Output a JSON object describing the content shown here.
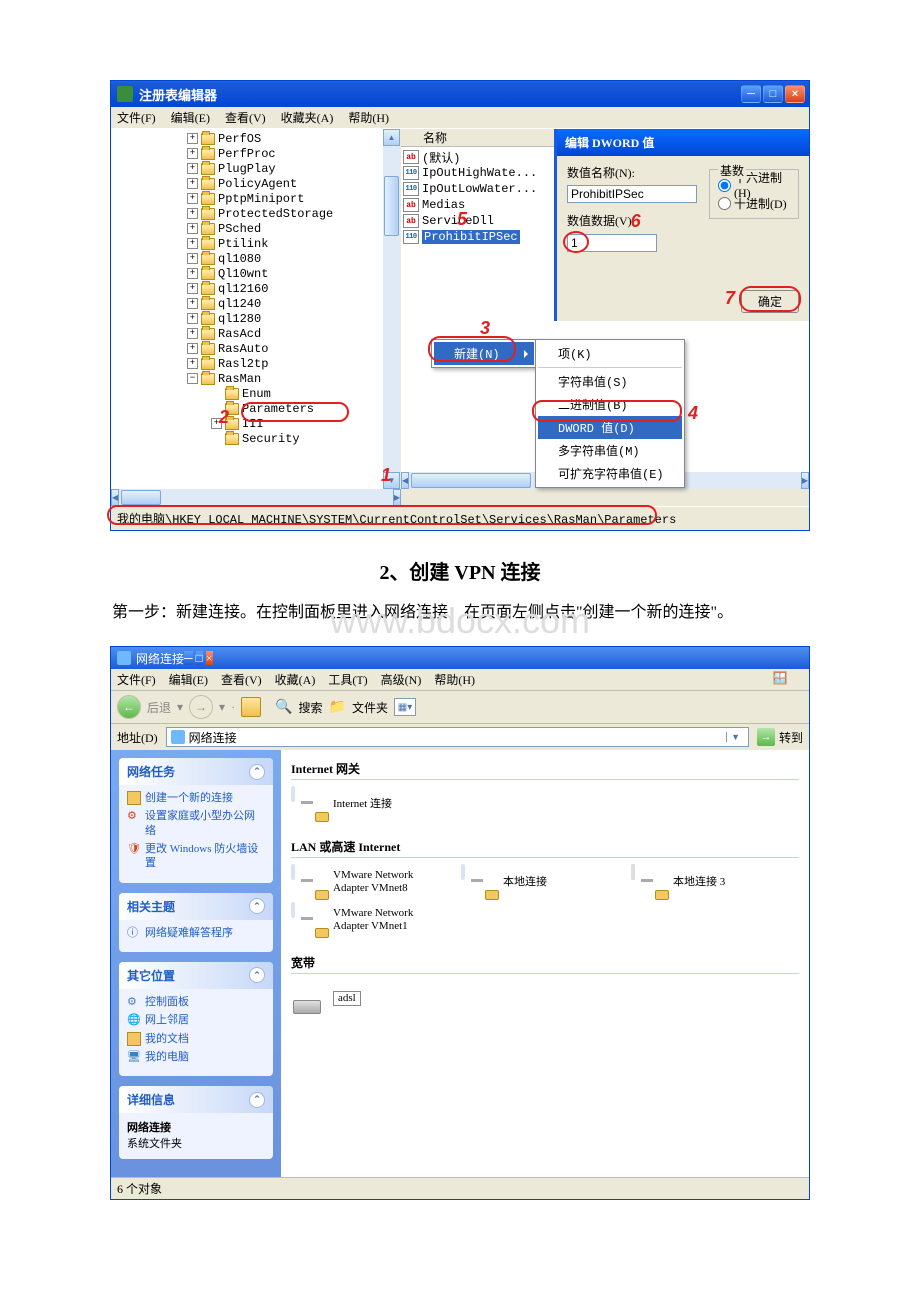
{
  "watermark": "www.bdocx.com",
  "regedit": {
    "title": "注册表编辑器",
    "menus": [
      "文件(F)",
      "编辑(E)",
      "查看(V)",
      "收藏夹(A)",
      "帮助(H)"
    ],
    "tree": [
      {
        "indent": 6,
        "exp": "+",
        "label": "PerfOS"
      },
      {
        "indent": 6,
        "exp": "+",
        "label": "PerfProc"
      },
      {
        "indent": 6,
        "exp": "+",
        "label": "PlugPlay"
      },
      {
        "indent": 6,
        "exp": "+",
        "label": "PolicyAgent"
      },
      {
        "indent": 6,
        "exp": "+",
        "label": "PptpMiniport"
      },
      {
        "indent": 6,
        "exp": "+",
        "label": "ProtectedStorage"
      },
      {
        "indent": 6,
        "exp": "+",
        "label": "PSched"
      },
      {
        "indent": 6,
        "exp": "+",
        "label": "Ptilink"
      },
      {
        "indent": 6,
        "exp": "+",
        "label": "ql1080"
      },
      {
        "indent": 6,
        "exp": "+",
        "label": "Ql10wnt"
      },
      {
        "indent": 6,
        "exp": "+",
        "label": "ql12160"
      },
      {
        "indent": 6,
        "exp": "+",
        "label": "ql1240"
      },
      {
        "indent": 6,
        "exp": "+",
        "label": "ql1280"
      },
      {
        "indent": 6,
        "exp": "+",
        "label": "RasAcd"
      },
      {
        "indent": 6,
        "exp": "+",
        "label": "RasAuto"
      },
      {
        "indent": 6,
        "exp": "+",
        "label": "Rasl2tp"
      },
      {
        "indent": 6,
        "exp": "−",
        "label": "RasMan"
      },
      {
        "indent": 8,
        "exp": "",
        "label": "Enum"
      },
      {
        "indent": 8,
        "exp": "",
        "label": "Parameters"
      },
      {
        "indent": 8,
        "exp": "+",
        "label": "III"
      },
      {
        "indent": 8,
        "exp": "",
        "label": "Security"
      }
    ],
    "col_name": "名称",
    "values": [
      {
        "type": "ab",
        "label": "(默认)"
      },
      {
        "type": "bin",
        "label": "IpOutHighWate..."
      },
      {
        "type": "bin",
        "label": "IpOutLowWater..."
      },
      {
        "type": "ab",
        "label": "Medias"
      },
      {
        "type": "ab",
        "label": "ServiceDll"
      },
      {
        "type": "bin",
        "label": "ProhibitIPSec",
        "selected": true
      }
    ],
    "dword": {
      "title": "编辑 DWORD 值",
      "name_lbl": "数值名称(N):",
      "name_val": "ProhibitIPSec",
      "data_lbl": "数值数据(V)",
      "data_val": "1",
      "base_lbl": "基数",
      "radio_hex": "十六进制(H)",
      "radio_dec": "十进制(D)",
      "ok_btn": "确定"
    },
    "ctx_new": {
      "label": "新建(N)",
      "sub": [
        "项(K)",
        "字符串值(S)",
        "二进制值(B)",
        "DWORD 值(D)",
        "多字符串值(M)",
        "可扩充字符串值(E)"
      ]
    },
    "status": "我的电脑\\HKEY_LOCAL_MACHINE\\SYSTEM\\CurrentControlSet\\Services\\RasMan\\Parameters",
    "anno": {
      "n1": "1",
      "n2": "2",
      "n3": "3",
      "n4": "4",
      "n5": "5",
      "n6": "6",
      "n7": "7"
    }
  },
  "doc": {
    "heading": "2、创建 VPN 连接",
    "para": "第一步：新建连接。在控制面板里进入网络连接，在页面左侧点击\"创建一个新的连接\"。"
  },
  "nc": {
    "title": "网络连接",
    "menus": [
      "文件(F)",
      "编辑(E)",
      "查看(V)",
      "收藏(A)",
      "工具(T)",
      "高级(N)",
      "帮助(H)"
    ],
    "tb_back": "后退",
    "tb_search": "搜索",
    "tb_folder": "文件夹",
    "addr_lbl": "地址(D)",
    "addr_val": "网络连接",
    "go": "转到",
    "side": {
      "tasks_title": "网络任务",
      "tasks": [
        "创建一个新的连接",
        "设置家庭或小型办公网络",
        "更改 Windows 防火墙设置"
      ],
      "related_title": "相关主题",
      "related": [
        "网络疑难解答程序"
      ],
      "other_title": "其它位置",
      "other": [
        "控制面板",
        "网上邻居",
        "我的文档",
        "我的电脑"
      ],
      "detail_title": "详细信息",
      "detail_name": "网络连接",
      "detail_sub": "系统文件夹"
    },
    "groups": [
      {
        "title": "Internet 网关",
        "items": [
          {
            "label": "Internet 连接",
            "icon": "conn"
          }
        ]
      },
      {
        "title": "LAN 或高速 Internet",
        "items": [
          {
            "label": "VMware Network Adapter VMnet8",
            "icon": "conn"
          },
          {
            "label": "本地连接",
            "icon": "conn"
          },
          {
            "label": "本地连接 3",
            "icon": "conn-dim"
          },
          {
            "label": "VMware Network Adapter VMnet1",
            "icon": "conn"
          }
        ]
      },
      {
        "title": "宽带",
        "items": [
          {
            "label": "adsl",
            "icon": "box",
            "boxed": true
          }
        ]
      }
    ],
    "status": "6 个对象"
  }
}
